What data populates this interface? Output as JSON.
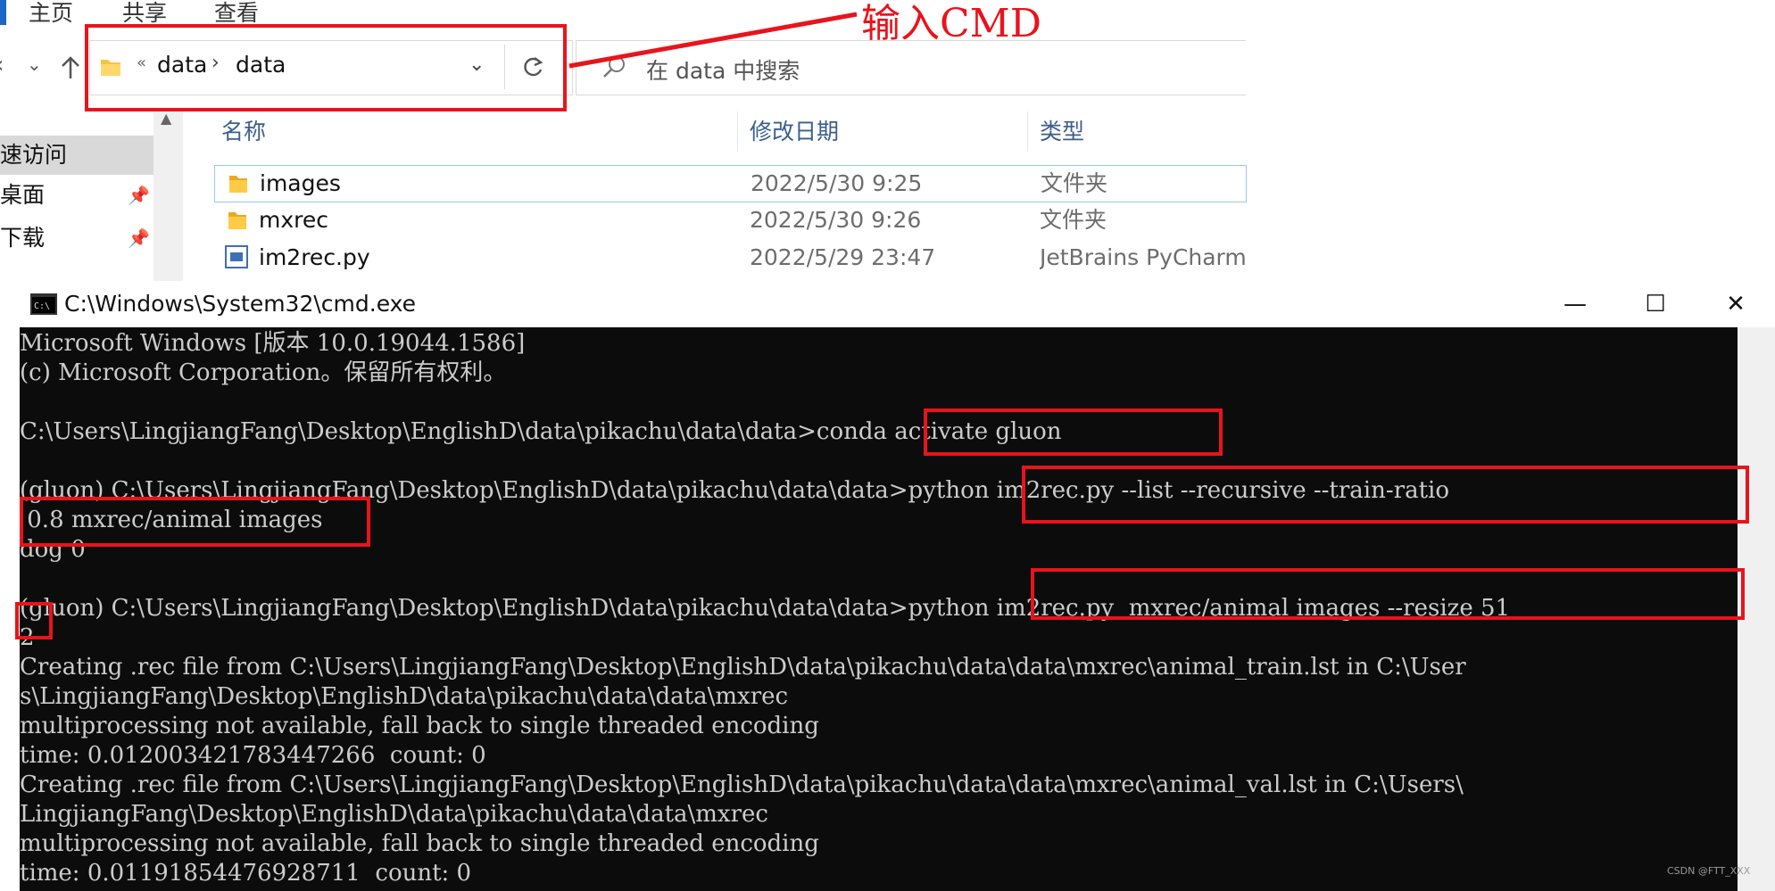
{
  "explorer": {
    "ribbon_tabs": [
      "主页",
      "共享",
      "查看"
    ],
    "address": {
      "overflow": "«",
      "crumbs": [
        "data",
        "data"
      ],
      "refresh_icon": "refresh-icon"
    },
    "search_placeholder": "在 data 中搜索",
    "nav_items": [
      "速访问",
      "桌面",
      "下载"
    ],
    "columns": [
      "名称",
      "修改日期",
      "类型"
    ],
    "files": [
      {
        "name": "images",
        "date": "2022/5/30 9:25",
        "type": "文件夹",
        "icon": "folder-icon"
      },
      {
        "name": "mxrec",
        "date": "2022/5/30 9:26",
        "type": "文件夹",
        "icon": "folder-icon"
      },
      {
        "name": "im2rec.py",
        "date": "2022/5/29 23:47",
        "type": "JetBrains PyCharm .",
        "icon": "python-file-icon"
      }
    ]
  },
  "cmd": {
    "title": "C:\\Windows\\System32\\cmd.exe",
    "lines": [
      "Microsoft Windows [版本 10.0.19044.1586]",
      "(c) Microsoft Corporation。保留所有权利。",
      "",
      "C:\\Users\\LingjiangFang\\Desktop\\EnglishD\\data\\pikachu\\data\\data>conda activate gluon",
      "",
      "(gluon) C:\\Users\\LingjiangFang\\Desktop\\EnglishD\\data\\pikachu\\data\\data>python im2rec.py --list --recursive --train-ratio",
      " 0.8 mxrec/animal images",
      "dog 0",
      "",
      "(gluon) C:\\Users\\LingjiangFang\\Desktop\\EnglishD\\data\\pikachu\\data\\data>python im2rec.py  mxrec/animal images --resize 51",
      "2",
      "Creating .rec file from C:\\Users\\LingjiangFang\\Desktop\\EnglishD\\data\\pikachu\\data\\data\\mxrec\\animal_train.lst in C:\\User",
      "s\\LingjiangFang\\Desktop\\EnglishD\\data\\pikachu\\data\\data\\mxrec",
      "multiprocessing not available, fall back to single threaded encoding",
      "time: 0.012003421783447266  count: 0",
      "Creating .rec file from C:\\Users\\LingjiangFang\\Desktop\\EnglishD\\data\\pikachu\\data\\data\\mxrec\\animal_val.lst in C:\\Users\\",
      "LingjiangFang\\Desktop\\EnglishD\\data\\pikachu\\data\\data\\mxrec",
      "multiprocessing not available, fall back to single threaded encoding",
      "time: 0.01191854476928711  count: 0"
    ]
  },
  "annotation": "输入CMD",
  "watermark": "CSDN @FTT_XXX",
  "colors": {
    "annotation_red": "#e8141c",
    "console_bg": "#0c0c0c",
    "console_fg": "#cccccc"
  }
}
